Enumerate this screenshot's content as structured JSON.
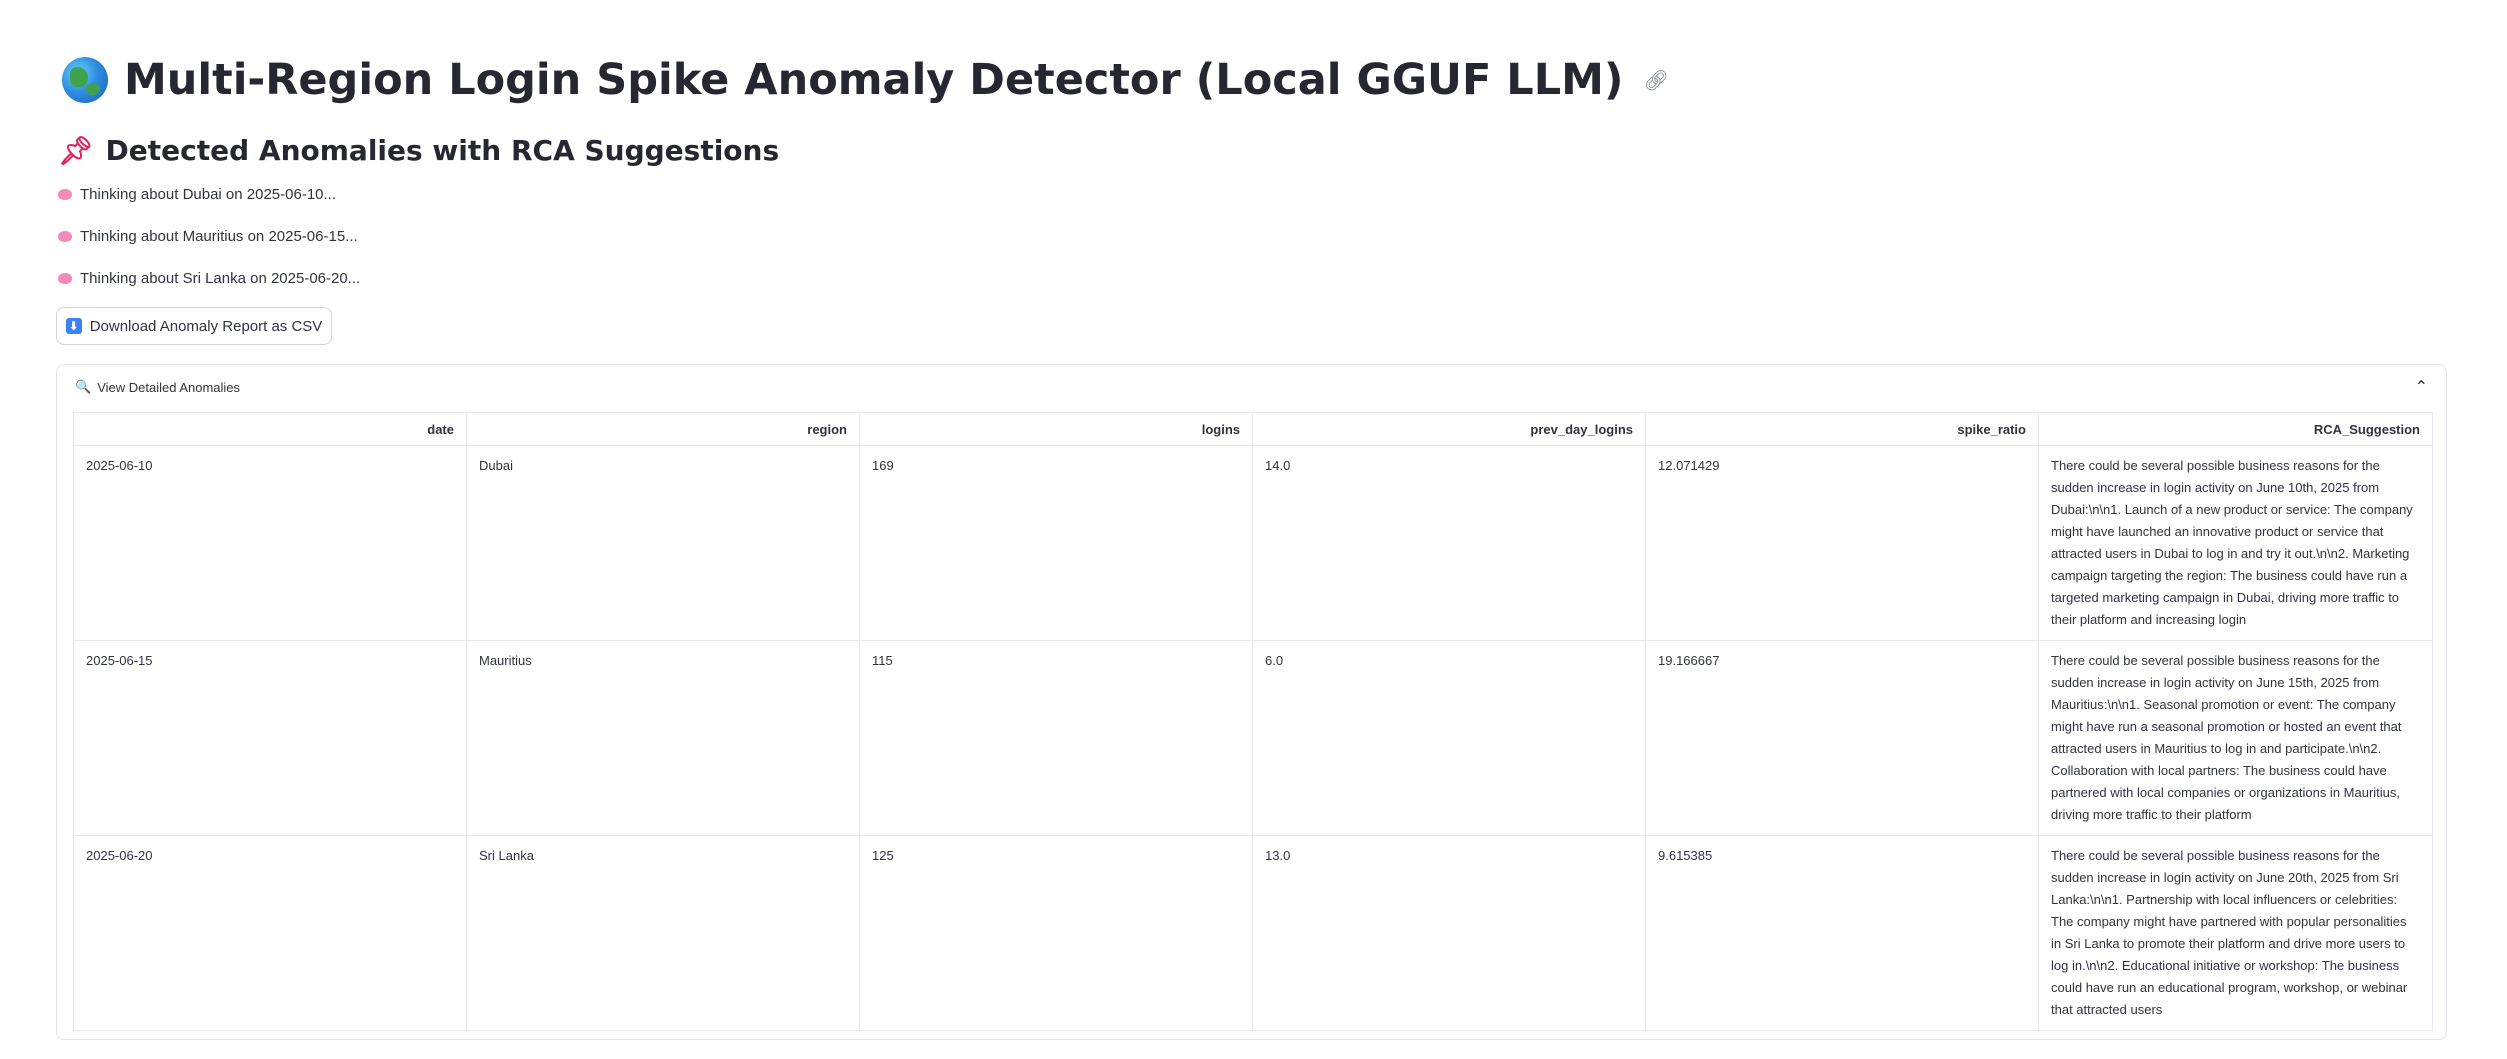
{
  "header": {
    "title": "Multi-Region Login Spike Anomaly Detector (Local GGUF LLM)",
    "title_icon": "globe-icon",
    "link_icon": "link-icon"
  },
  "section": {
    "title": "Detected Anomalies with RCA Suggestions",
    "icon": "pushpin-icon"
  },
  "thinking": [
    {
      "icon": "brain-icon",
      "text": "Thinking about Dubai on 2025-06-10..."
    },
    {
      "icon": "brain-icon",
      "text": "Thinking about Mauritius on 2025-06-15..."
    },
    {
      "icon": "brain-icon",
      "text": "Thinking about Sri Lanka on 2025-06-20..."
    }
  ],
  "download_button": {
    "icon": "download-icon",
    "icon_glyph": "⬇",
    "label": "Download Anomaly Report as CSV"
  },
  "expander": {
    "label": "View Detailed Anomalies",
    "icon": "magnifier-icon",
    "icon_glyph": "🔍",
    "state_icon": "chevron-up-icon"
  },
  "table": {
    "columns": [
      "date",
      "region",
      "logins",
      "prev_day_logins",
      "spike_ratio",
      "RCA_Suggestion"
    ],
    "rows": [
      {
        "date": "2025-06-10",
        "region": "Dubai",
        "logins": "169",
        "prev_day_logins": "14.0",
        "spike_ratio": "12.071429",
        "RCA_Suggestion": "There could be several possible business reasons for the sudden increase in login activity on June 10th, 2025 from Dubai:\\n\\n1. Launch of a new product or service: The company might have launched an innovative product or service that attracted users in Dubai to log in and try it out.\\n\\n2. Marketing campaign targeting the region: The business could have run a targeted marketing campaign in Dubai, driving more traffic to their platform and increasing login"
      },
      {
        "date": "2025-06-15",
        "region": "Mauritius",
        "logins": "115",
        "prev_day_logins": "6.0",
        "spike_ratio": "19.166667",
        "RCA_Suggestion": "There could be several possible business reasons for the sudden increase in login activity on June 15th, 2025 from Mauritius:\\n\\n1. Seasonal promotion or event: The company might have run a seasonal promotion or hosted an event that attracted users in Mauritius to log in and participate.\\n\\n2. Collaboration with local partners: The business could have partnered with local companies or organizations in Mauritius, driving more traffic to their platform"
      },
      {
        "date": "2025-06-20",
        "region": "Sri Lanka",
        "logins": "125",
        "prev_day_logins": "13.0",
        "spike_ratio": "9.615385",
        "RCA_Suggestion": "There could be several possible business reasons for the sudden increase in login activity on June 20th, 2025 from Sri Lanka:\\n\\n1. Partnership with local influencers or celebrities: The company might have partnered with popular personalities in Sri Lanka to promote their platform and drive more users to log in.\\n\\n2. Educational initiative or workshop: The business could have run an educational program, workshop, or webinar that attracted users"
      }
    ]
  },
  "colors": {
    "text": "#31333f",
    "heading": "#262730",
    "border": "#e3e4e8",
    "accent": "#3b82f6"
  }
}
